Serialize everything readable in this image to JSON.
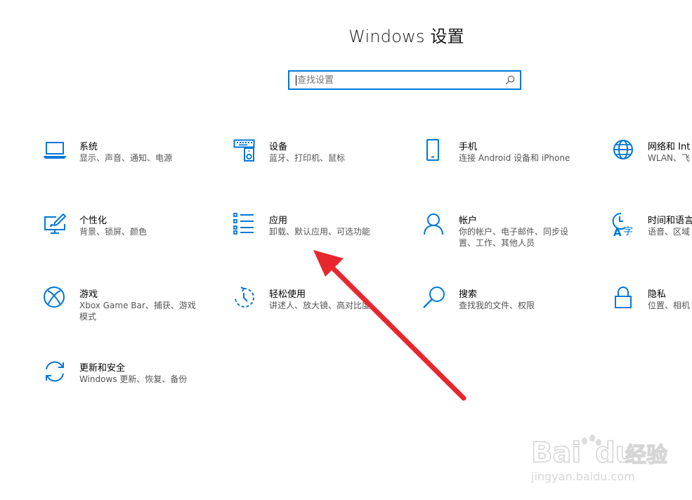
{
  "window": {
    "title": "Windows 设置"
  },
  "search": {
    "placeholder": "查找设置",
    "icon": "search-icon"
  },
  "accent_color": "#0078d7",
  "annotation_color": "#e8262e",
  "tiles": [
    {
      "name": "系统",
      "desc": "显示、声音、通知、电源",
      "icon": "laptop-icon"
    },
    {
      "name": "设备",
      "desc": "蓝牙、打印机、鼠标",
      "icon": "keyboard-speaker-icon"
    },
    {
      "name": "手机",
      "desc": "连接 Android 设备和 iPhone",
      "icon": "phone-icon"
    },
    {
      "name": "网络和 Int",
      "desc": "WLAN、飞",
      "icon": "globe-icon"
    },
    {
      "name": "个性化",
      "desc": "背景、锁屏、颜色",
      "icon": "personalization-icon"
    },
    {
      "name": "应用",
      "desc": "卸载、默认应用、可选功能",
      "icon": "apps-list-icon"
    },
    {
      "name": "帐户",
      "desc": "你的帐户、电子邮件、同步设置、工作、其他人员",
      "icon": "person-icon"
    },
    {
      "name": "时间和语言",
      "desc": "语音、区域",
      "icon": "time-language-icon"
    },
    {
      "name": "游戏",
      "desc": "Xbox Game Bar、捕获、游戏模式",
      "icon": "xbox-icon"
    },
    {
      "name": "轻松使用",
      "desc": "讲述人、放大镜、高对比度",
      "icon": "ease-of-access-icon"
    },
    {
      "name": "搜索",
      "desc": "查找我的文件、权限",
      "icon": "magnifier-icon"
    },
    {
      "name": "隐私",
      "desc": "位置、相机",
      "icon": "lock-icon"
    },
    {
      "name": "更新和安全",
      "desc": "Windows 更新、恢复、备份",
      "icon": "sync-icon"
    }
  ],
  "watermark": {
    "brand": "Bai",
    "brand2": "du",
    "service": "经验",
    "url": "jingyan.baidu.com"
  }
}
